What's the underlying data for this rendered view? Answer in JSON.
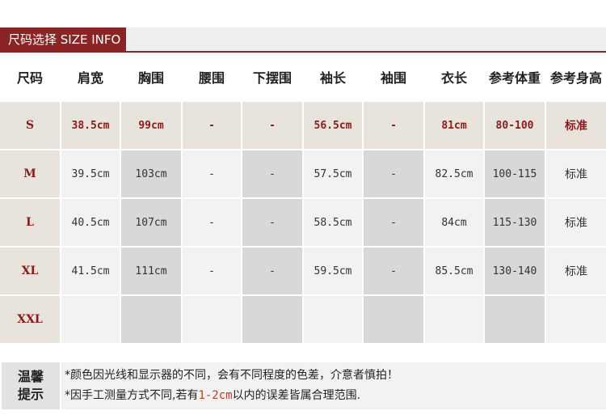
{
  "header": {
    "title": "尺码选择 SIZE INFO"
  },
  "table": {
    "columns": [
      "尺码",
      "肩宽",
      "胸围",
      "腰围",
      "下摆围",
      "袖长",
      "袖围",
      "衣长",
      "参考体重",
      "参考身高"
    ],
    "rows": [
      [
        "S",
        "38.5cm",
        "99cm",
        "-",
        "-",
        "56.5cm",
        "-",
        "81cm",
        "80-100",
        "标准"
      ],
      [
        "M",
        "39.5cm",
        "103cm",
        "-",
        "-",
        "57.5cm",
        "-",
        "82.5cm",
        "100-115",
        "标准"
      ],
      [
        "L",
        "40.5cm",
        "107cm",
        "-",
        "-",
        "58.5cm",
        "-",
        "84cm",
        "115-130",
        "标准"
      ],
      [
        "XL",
        "41.5cm",
        "111cm",
        "-",
        "-",
        "59.5cm",
        "-",
        "85.5cm",
        "130-140",
        "标准"
      ],
      [
        "XXL",
        "",
        "",
        "",
        "",
        "",
        "",
        "",
        "",
        ""
      ]
    ]
  },
  "tips": {
    "label_line1": "温馨",
    "label_line2": "提示",
    "note1": "*颜色因光线和显示器的不同，会有不同程度的色差，介意者慎拍！",
    "note2_pre": "*因手工测量方式不同,若有",
    "note2_hl": "1-2cm",
    "note2_post": "以内的误差皆属合理范围."
  },
  "colors": {
    "accent": "#8b2424",
    "highlight": "#c0392b"
  }
}
